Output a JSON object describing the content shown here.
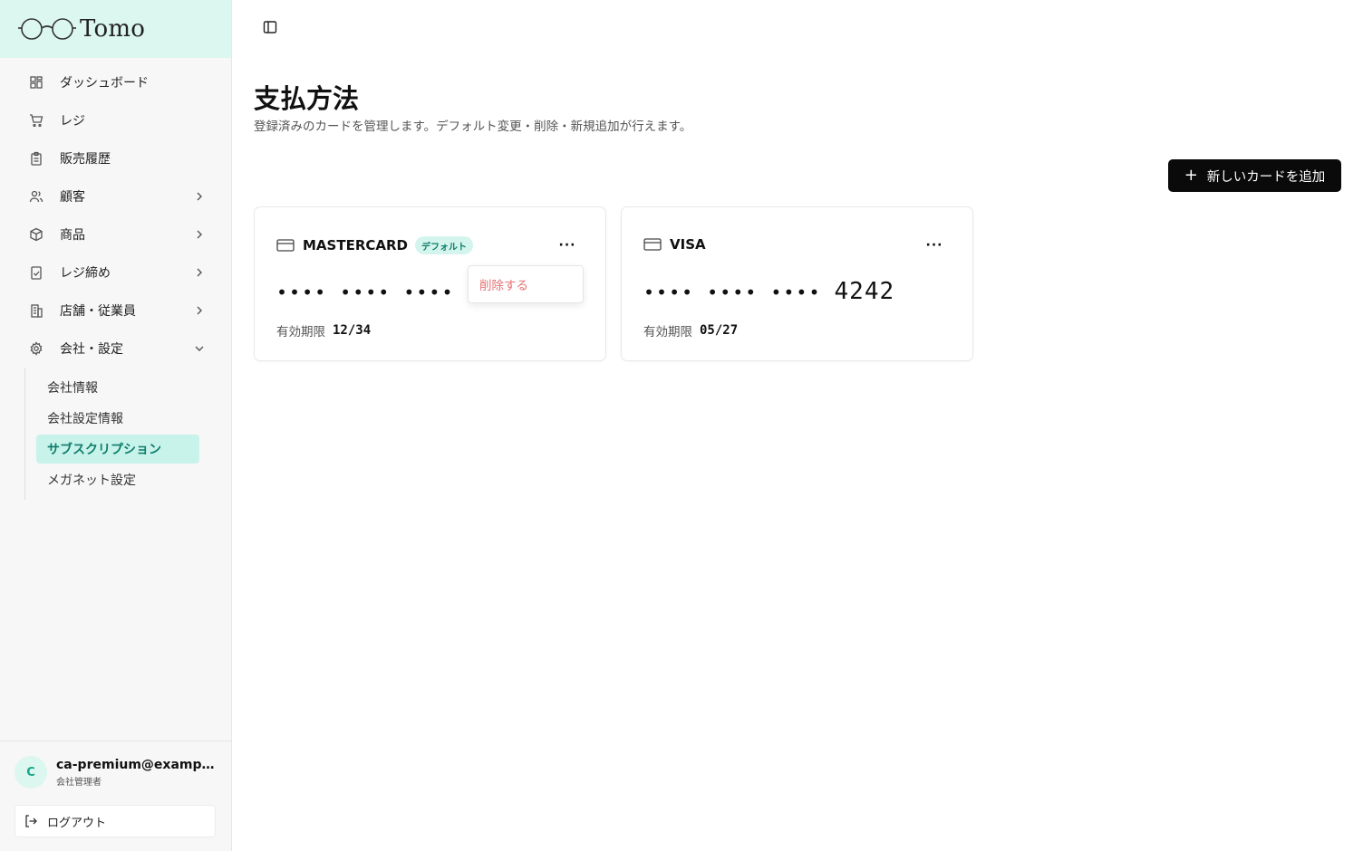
{
  "app": {
    "brand_name": "Tomo",
    "accent": "#dcf7f0"
  },
  "sidebar": {
    "items": [
      {
        "label": "ダッシュボード",
        "icon": "grid-icon"
      },
      {
        "label": "レジ",
        "icon": "cart-icon"
      },
      {
        "label": "販売履歴",
        "icon": "clipboard-icon"
      },
      {
        "label": "顧客",
        "icon": "users-icon",
        "chevron": "right"
      },
      {
        "label": "商品",
        "icon": "box-icon",
        "chevron": "right"
      },
      {
        "label": "レジ締め",
        "icon": "clipboard-check-icon",
        "chevron": "right"
      },
      {
        "label": "店舗・従業員",
        "icon": "building-icon",
        "chevron": "right"
      },
      {
        "label": "会社・設定",
        "icon": "gear-icon",
        "chevron": "down"
      }
    ],
    "sub_items": [
      {
        "label": "会社情報"
      },
      {
        "label": "会社設定情報"
      },
      {
        "label": "サブスクリプション",
        "active": true
      },
      {
        "label": "メガネット設定"
      }
    ],
    "user": {
      "avatar_initial": "C",
      "email": "ca-premium@example.com",
      "role": "会社管理者"
    },
    "logout_label": "ログアウト"
  },
  "main": {
    "title": "支払方法",
    "subtitle": "登録済みのカードを管理します。デフォルト変更・削除・新規追加が行えます。",
    "add_button_label": "新しいカードを追加",
    "cards": [
      {
        "brand": "MASTERCARD",
        "badge": "デフォルト",
        "masked": "••••",
        "expiry_label": "有効期限",
        "expiry": "12/34"
      },
      {
        "brand": "VISA",
        "masked": "••••",
        "last4": "4242",
        "expiry_label": "有効期限",
        "expiry": "05/27"
      }
    ],
    "context_menu": {
      "delete_label": "削除する",
      "delete_color": "#e57373"
    }
  }
}
